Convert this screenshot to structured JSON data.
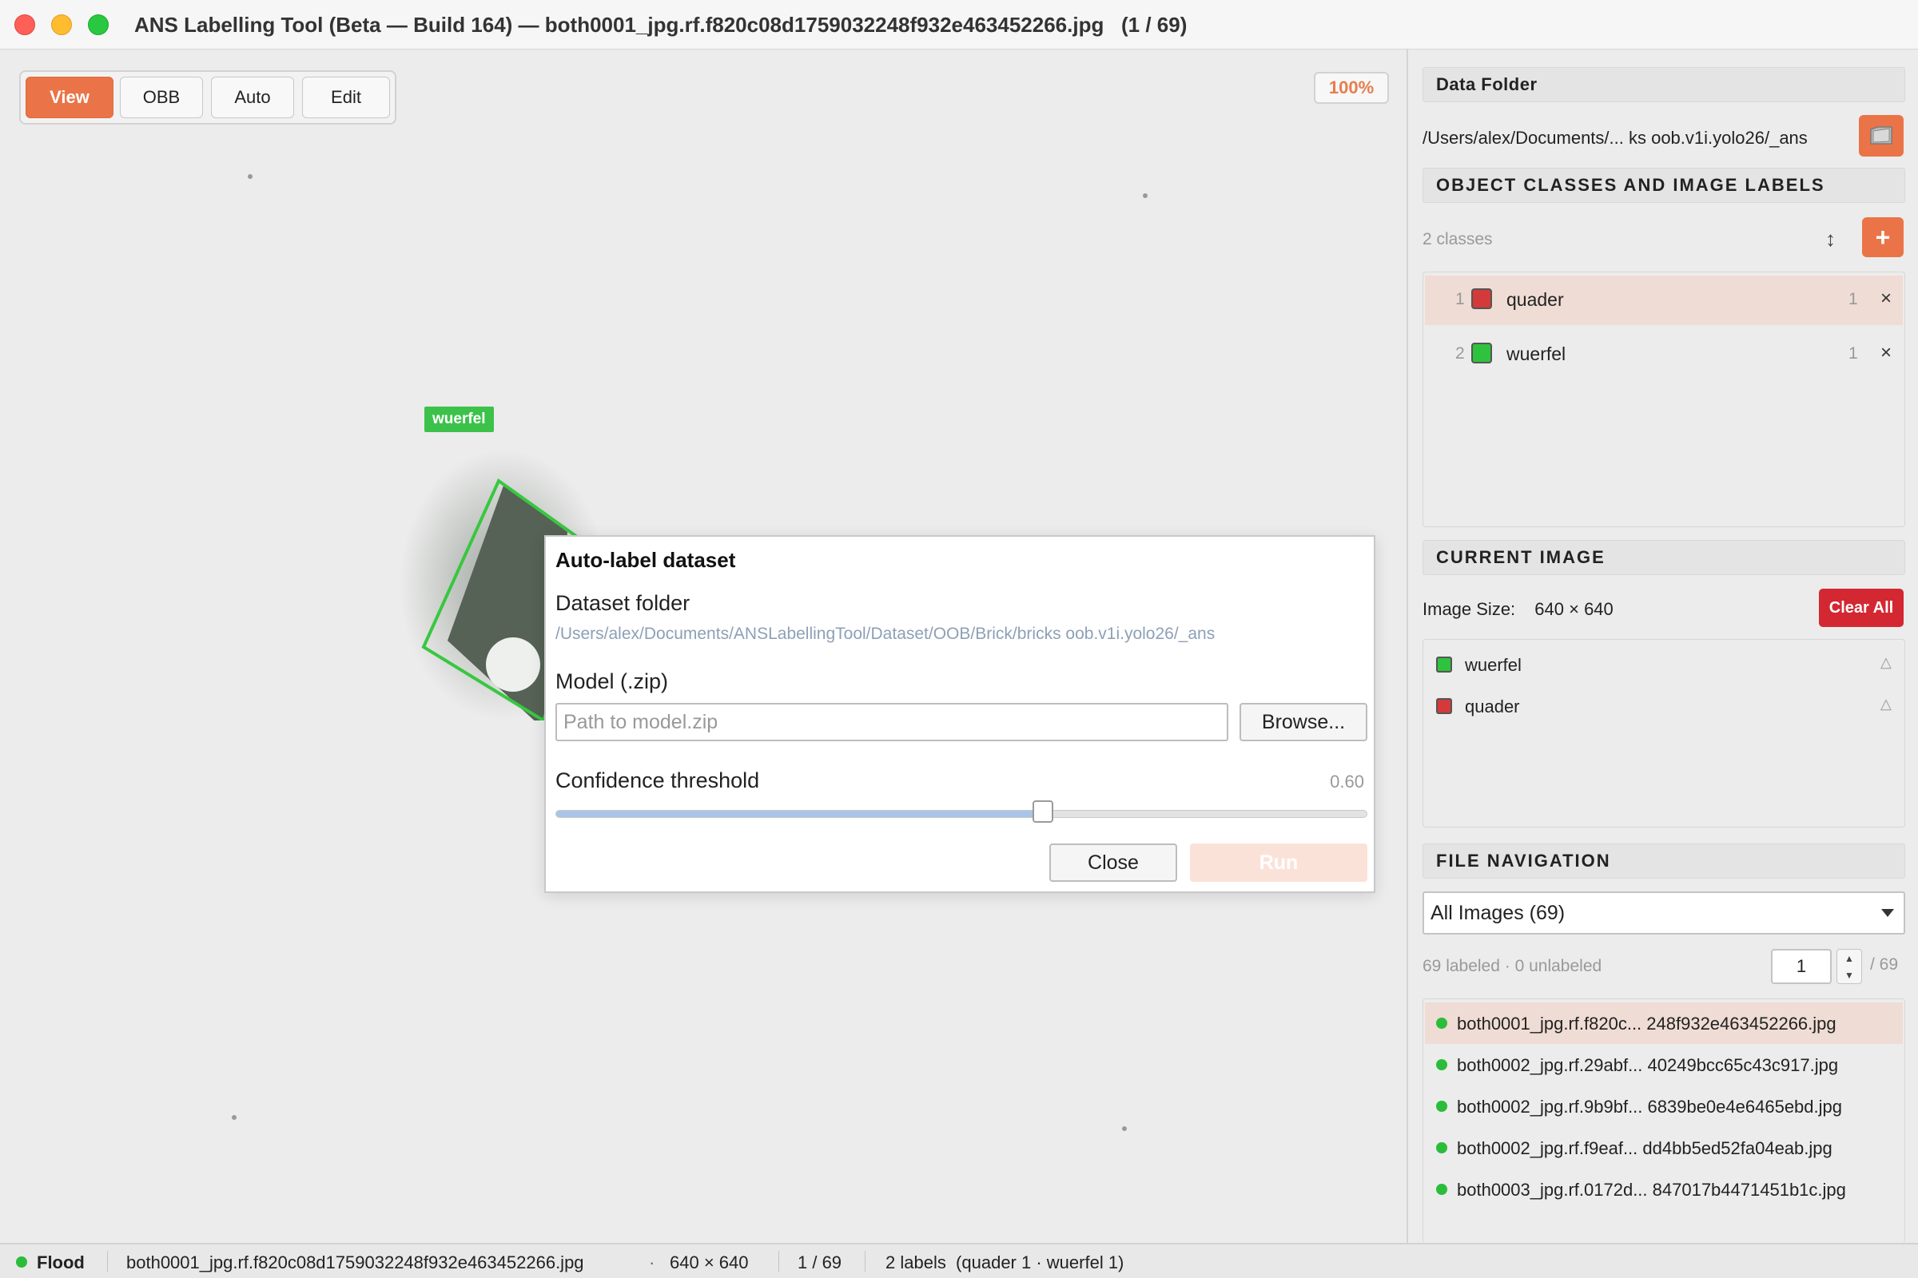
{
  "window": {
    "title": "ANS Labelling Tool (Beta — Build 164) — both0001_jpg.rf.f820c08d1759032248f932e463452266.jpg   (1 / 69)"
  },
  "toolbar": {
    "modes": [
      {
        "label": "View",
        "active": true
      },
      {
        "label": "OBB",
        "active": false
      },
      {
        "label": "Auto",
        "active": false
      },
      {
        "label": "Edit",
        "active": false
      }
    ],
    "zoom": "100%"
  },
  "canvas": {
    "annotation_label": "wuerfel"
  },
  "dialog": {
    "title": "Auto-label dataset",
    "dataset_label": "Dataset folder",
    "dataset_path": "/Users/alex/Documents/ANSLabellingTool/Dataset/OOB/Brick/bricks oob.v1i.yolo26/_ans",
    "model_label": "Model (.zip)",
    "model_placeholder": "Path to model.zip",
    "browse_label": "Browse...",
    "confidence_label": "Confidence threshold",
    "confidence_value": "0.60",
    "confidence": 0.6,
    "close_label": "Close",
    "run_label": "Run"
  },
  "panel": {
    "data_folder": {
      "header": "Data Folder",
      "path": "/Users/alex/Documents/... ks oob.v1i.yolo26/_ans"
    },
    "classes": {
      "header": "OBJECT CLASSES AND IMAGE LABELS",
      "count": "2 classes",
      "sort_icon": "↕",
      "add_label": "+",
      "items": [
        {
          "num": "1",
          "name": "quader",
          "color": "#d43a3a",
          "count": "1",
          "delete": "×",
          "selected": true
        },
        {
          "num": "2",
          "name": "wuerfel",
          "color": "#2fc23d",
          "count": "1",
          "delete": "×",
          "selected": false
        }
      ]
    },
    "current_image": {
      "header": "CURRENT IMAGE",
      "size_label": "Image Size:",
      "size_value": "640 × 640",
      "clear_label": "Clear All",
      "labels": [
        {
          "name": "wuerfel",
          "color": "#2fc23d",
          "marker": "△"
        },
        {
          "name": "quader",
          "color": "#d43a3a",
          "marker": "△"
        }
      ]
    },
    "file_nav": {
      "header": "FILE NAVIGATION",
      "filter": "All Images (69)",
      "summary": "69 labeled · 0 unlabeled",
      "page": "1",
      "page_total": "/ 69",
      "files": [
        {
          "name": "both0001_jpg.rf.f820c... 248f932e463452266.jpg",
          "selected": true
        },
        {
          "name": "both0002_jpg.rf.29abf... 40249bcc65c43c917.jpg",
          "selected": false
        },
        {
          "name": "both0002_jpg.rf.9b9bf... 6839be0e4e6465ebd.jpg",
          "selected": false
        },
        {
          "name": "both0002_jpg.rf.f9eaf... dd4bb5ed52fa04eab.jpg",
          "selected": false
        },
        {
          "name": "both0003_jpg.rf.0172d... 847017b4471451b1c.jpg",
          "selected": false
        }
      ]
    }
  },
  "status": {
    "mode": "Flood",
    "file": "both0001_jpg.rf.f820c08d1759032248f932e463452266.jpg",
    "dims": "640 × 640",
    "index": "1 / 69",
    "labels": "2 labels  (quader 1 · wuerfel 1)",
    "dot_separator": "·"
  },
  "colors": {
    "accent": "#ea7447",
    "danger": "#d32732",
    "success": "#2bbd3a"
  }
}
